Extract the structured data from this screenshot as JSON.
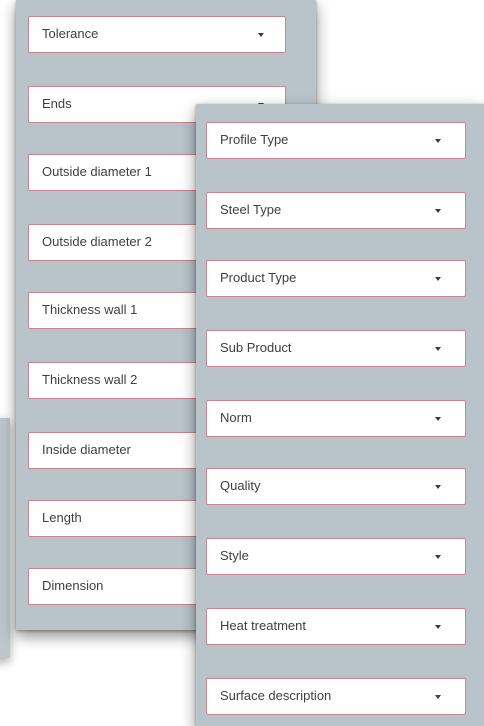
{
  "left_panel": {
    "fields": [
      {
        "label": "Tolerance"
      },
      {
        "label": "Ends"
      },
      {
        "label": "Outside diameter 1"
      },
      {
        "label": "Outside diameter 2"
      },
      {
        "label": "Thickness wall 1"
      },
      {
        "label": "Thickness wall 2"
      },
      {
        "label": "Inside diameter"
      },
      {
        "label": "Length"
      },
      {
        "label": "Dimension"
      }
    ]
  },
  "right_panel": {
    "fields": [
      {
        "label": "Profile Type"
      },
      {
        "label": "Steel Type"
      },
      {
        "label": "Product Type"
      },
      {
        "label": "Sub Product"
      },
      {
        "label": "Norm"
      },
      {
        "label": "Quality"
      },
      {
        "label": "Style"
      },
      {
        "label": "Heat treatment"
      },
      {
        "label": "Surface description"
      }
    ]
  },
  "colors": {
    "panel_background": "#b8c4ca",
    "field_border": "#c9868f",
    "field_background": "#ffffff"
  },
  "icons": {
    "dropdown": "chevron-down-icon"
  }
}
